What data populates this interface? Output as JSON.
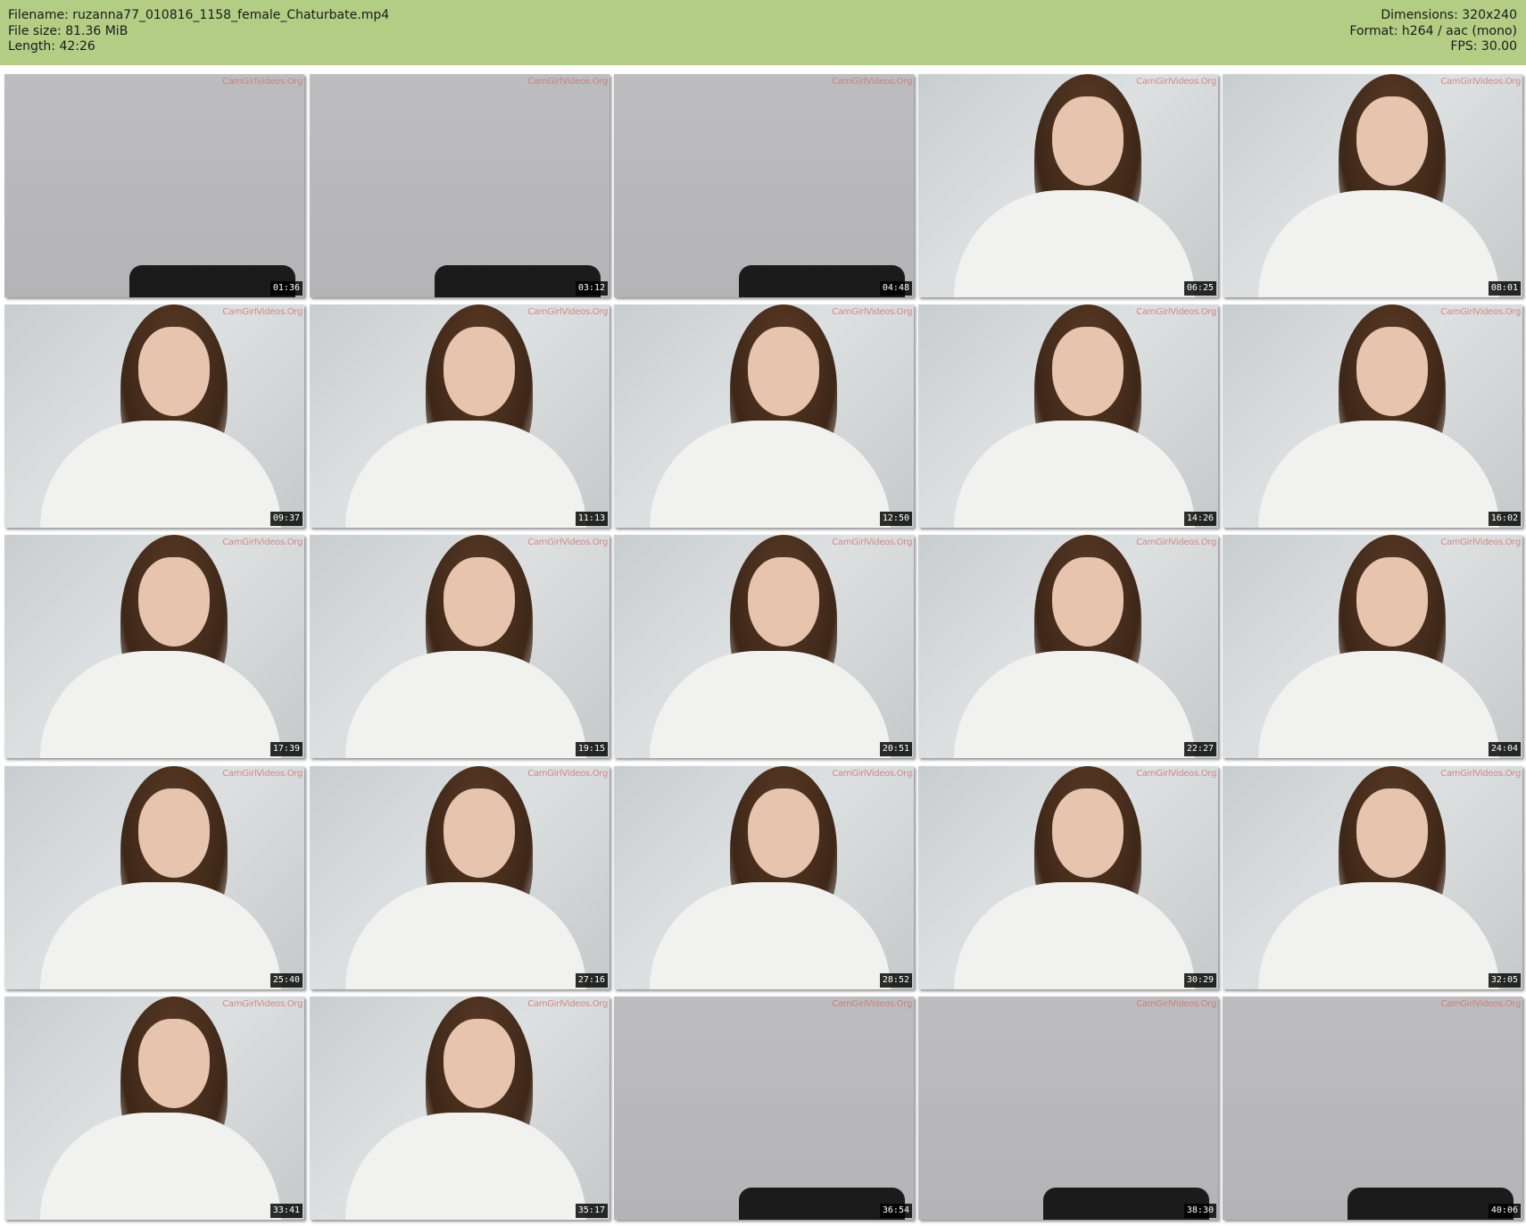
{
  "header": {
    "filename": "Filename: ruzanna77_010816_1158_female_Chaturbate.mp4",
    "filesize": "File size: 81.36 MiB",
    "length": "Length: 42:26",
    "dimensions": "Dimensions: 320x240",
    "format": "Format: h264 / aac (mono)",
    "fps": "FPS: 30.00"
  },
  "colors": {
    "header_bg": "#b4cd84",
    "timestamp_bg": "#000000"
  },
  "watermark": "CamGirlVideos.Org",
  "thumbnails": [
    {
      "time": "01:36",
      "scene": "empty-chair"
    },
    {
      "time": "03:12",
      "scene": "empty-chair"
    },
    {
      "time": "04:48",
      "scene": "empty-chair"
    },
    {
      "time": "06:25",
      "scene": "person"
    },
    {
      "time": "08:01",
      "scene": "person"
    },
    {
      "time": "09:37",
      "scene": "person"
    },
    {
      "time": "11:13",
      "scene": "person"
    },
    {
      "time": "12:50",
      "scene": "person"
    },
    {
      "time": "14:26",
      "scene": "person"
    },
    {
      "time": "16:02",
      "scene": "person"
    },
    {
      "time": "17:39",
      "scene": "person"
    },
    {
      "time": "19:15",
      "scene": "person"
    },
    {
      "time": "20:51",
      "scene": "person"
    },
    {
      "time": "22:27",
      "scene": "person"
    },
    {
      "time": "24:04",
      "scene": "person"
    },
    {
      "time": "25:40",
      "scene": "person"
    },
    {
      "time": "27:16",
      "scene": "person"
    },
    {
      "time": "28:52",
      "scene": "person"
    },
    {
      "time": "30:29",
      "scene": "person"
    },
    {
      "time": "32:05",
      "scene": "person"
    },
    {
      "time": "33:41",
      "scene": "person"
    },
    {
      "time": "35:17",
      "scene": "person"
    },
    {
      "time": "36:54",
      "scene": "empty-chair"
    },
    {
      "time": "38:30",
      "scene": "empty-chair"
    },
    {
      "time": "40:06",
      "scene": "empty-chair"
    }
  ]
}
